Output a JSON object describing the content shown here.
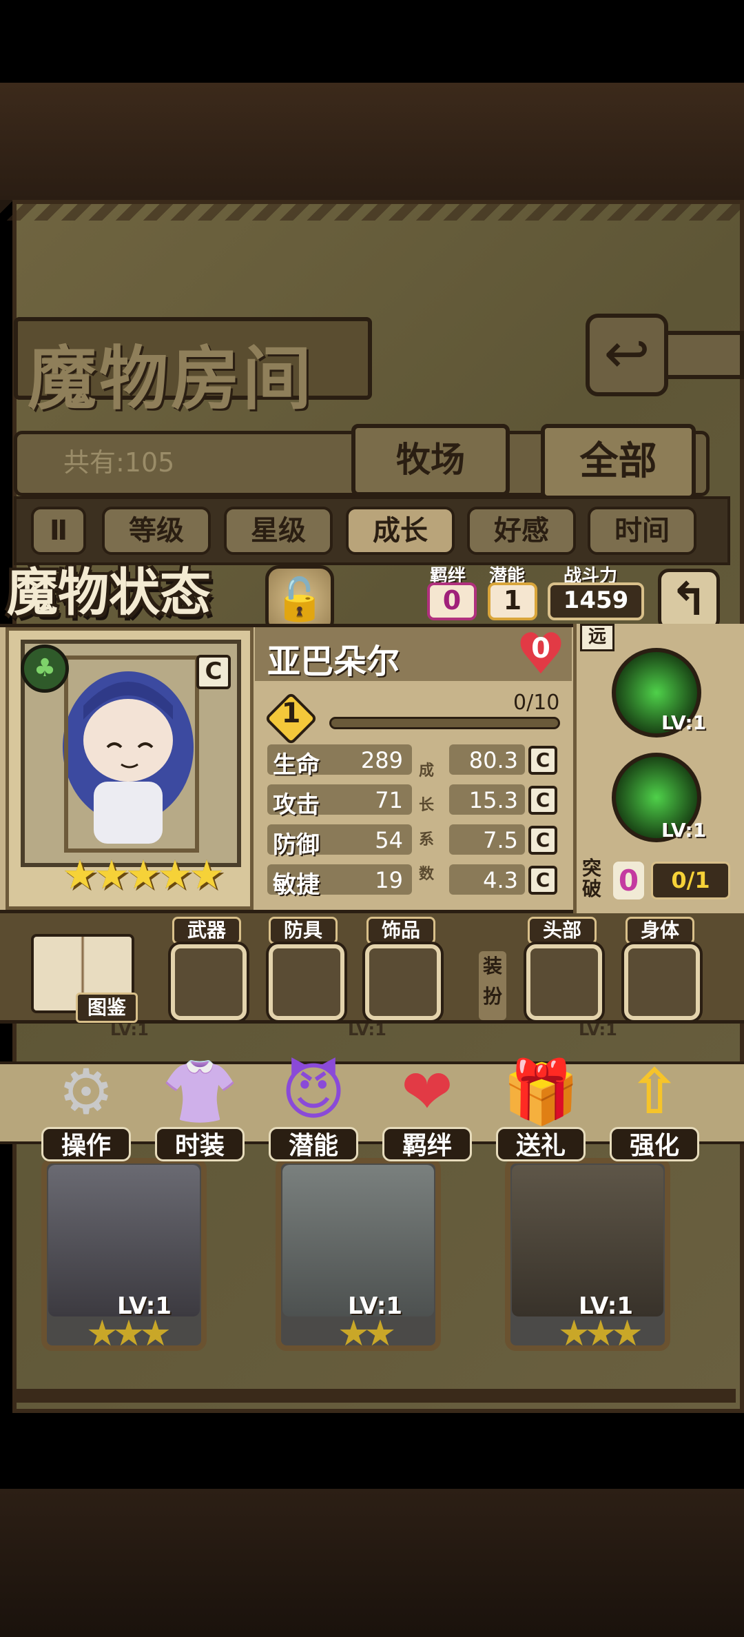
{
  "room": {
    "title": "魔物房间",
    "count_label": "共有:105",
    "tabs": [
      "牧场",
      "全部"
    ]
  },
  "sort": {
    "toggle": "Ⅱ",
    "buttons": [
      "等级",
      "星级",
      "成长",
      "好感",
      "时间"
    ],
    "active": "成长"
  },
  "status": {
    "title": "魔物状态",
    "bond_label": "羁绊",
    "bond_value": "0",
    "potential_label": "潜能",
    "potential_value": "1",
    "power_label": "战斗力",
    "power_value": "1459"
  },
  "monster": {
    "name": "亚巴朵尔",
    "class_tag": "C",
    "element": "grass",
    "affection": "0",
    "level": "1",
    "exp": "0/10",
    "exp_fraction": 0,
    "stars": 5,
    "growth_side_label": [
      "成",
      "长",
      "系",
      "数"
    ],
    "stats": [
      {
        "label": "生命",
        "value": "289",
        "growth": "80.3",
        "grade": "C"
      },
      {
        "label": "攻击",
        "value": "71",
        "growth": "15.3",
        "grade": "C"
      },
      {
        "label": "防御",
        "value": "54",
        "growth": "7.5",
        "grade": "C"
      },
      {
        "label": "敏捷",
        "value": "19",
        "growth": "4.3",
        "grade": "C"
      }
    ],
    "range": "远",
    "skills": [
      {
        "lv": "LV:1"
      },
      {
        "lv": "LV:1"
      }
    ],
    "breakthrough_label": "突破",
    "breakthrough_value": "0",
    "breakthrough_progress": "0/1"
  },
  "equipment": {
    "codex_label": "图鉴",
    "slots": [
      "武器",
      "防具",
      "饰品"
    ],
    "dress_label": "装扮",
    "dress_slots": [
      "头部",
      "身体"
    ]
  },
  "actions": [
    {
      "label": "操作",
      "icon": "gear-icon",
      "glyph": "⚙"
    },
    {
      "label": "时装",
      "icon": "outfit-icon",
      "glyph": "👚"
    },
    {
      "label": "潜能",
      "icon": "potential-icon",
      "glyph": "😈"
    },
    {
      "label": "羁绊",
      "icon": "bond-icon",
      "glyph": "❤"
    },
    {
      "label": "送礼",
      "icon": "gift-icon",
      "glyph": "🎁"
    },
    {
      "label": "强化",
      "icon": "upgrade-icon",
      "glyph": "⇧"
    }
  ],
  "cards": [
    {
      "lv": "LV:1",
      "stars": "★★★",
      "top_lv": "LV:1"
    },
    {
      "lv": "LV:1",
      "stars": "★★",
      "top_lv": "LV:1"
    },
    {
      "lv": "LV:1",
      "stars": "★★★",
      "top_lv": "LV:1"
    }
  ],
  "colors": {
    "accent_gold": "#f6d238",
    "bond_pink": "#c43aa0",
    "heart_red": "#e23a45",
    "skill_green": "#4fd14a"
  }
}
